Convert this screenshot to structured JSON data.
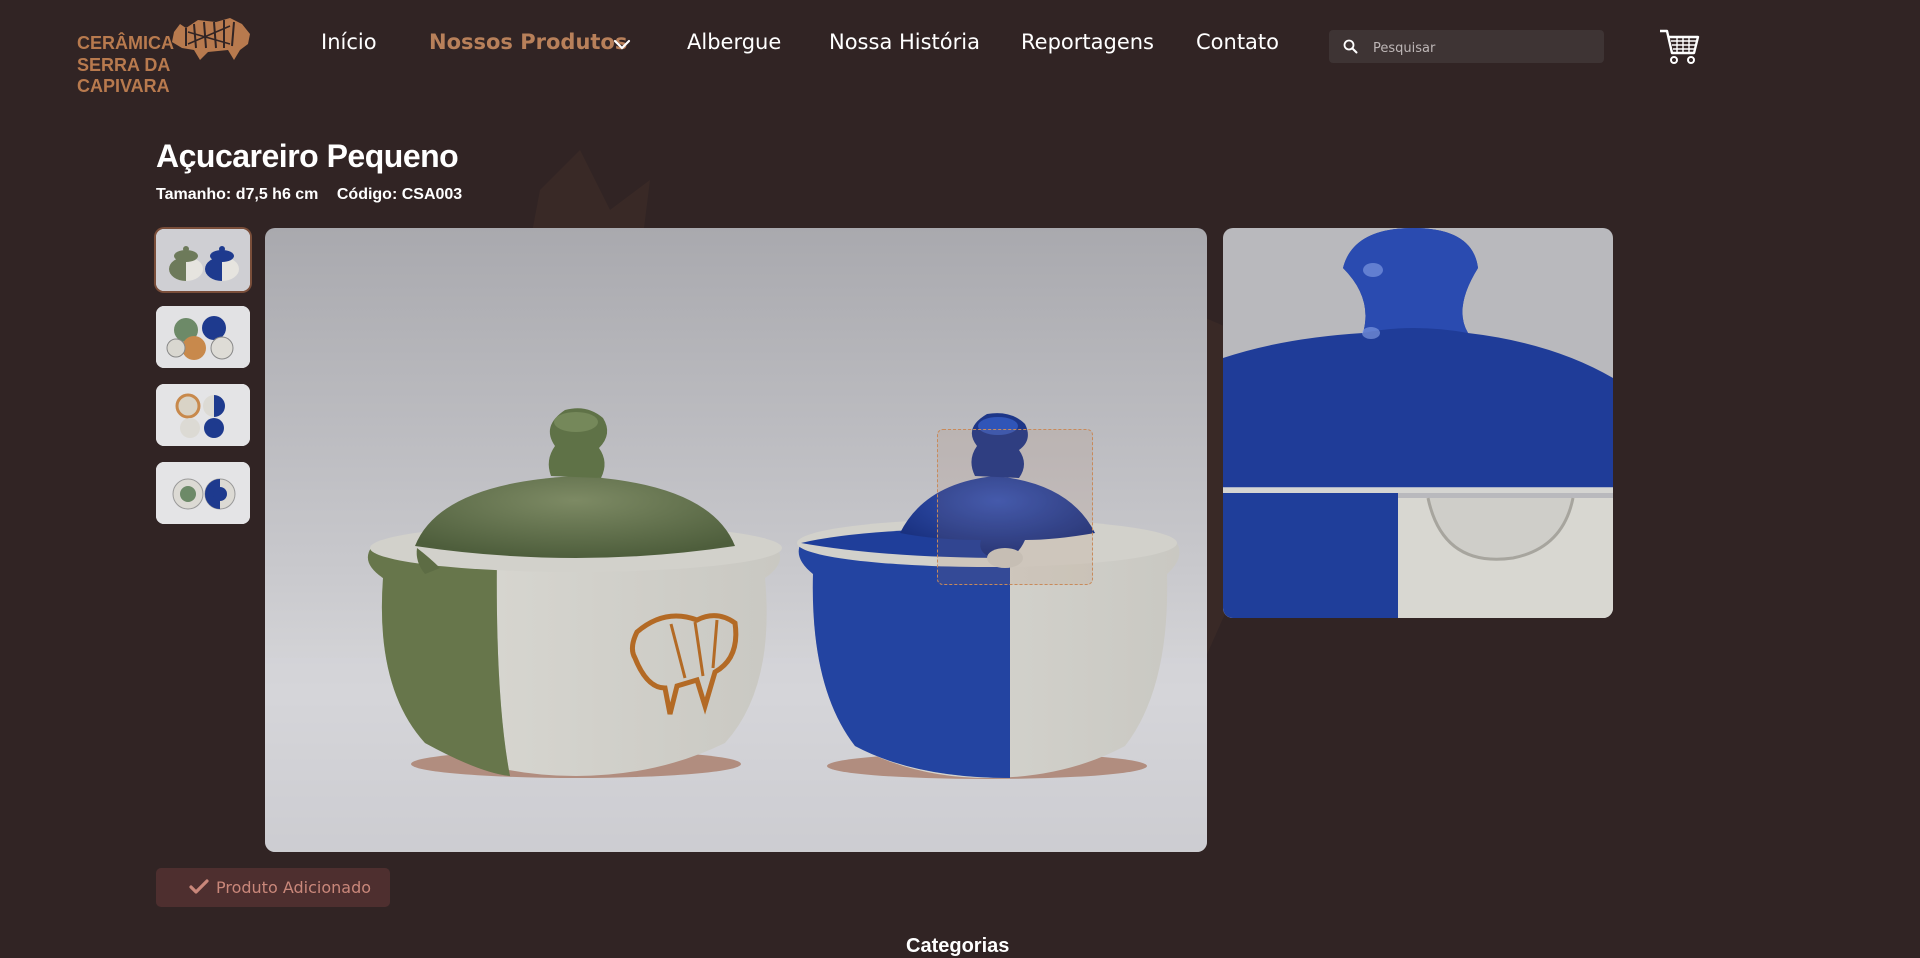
{
  "brand": {
    "line1": "CERÂMICA",
    "line2": "SERRA DA CAPIVARA",
    "color": "#b87a4e"
  },
  "nav": {
    "items": [
      {
        "label": "Início"
      },
      {
        "label": "Nossos Produtos",
        "active": true,
        "icon": "chevron-down-icon"
      },
      {
        "label": "Albergue"
      },
      {
        "label": "Nossa História"
      },
      {
        "label": "Reportagens"
      },
      {
        "label": "Contato"
      }
    ],
    "active_color": "#b8805a"
  },
  "search": {
    "placeholder": "Pesquisar",
    "icon": "search-icon"
  },
  "cart": {
    "icon": "cart-icon"
  },
  "product": {
    "title": "Açucareiro Pequeno",
    "size": "Tamanho: d7,5 h6 cm",
    "code": "Código: CSA003",
    "images": {
      "count": 4,
      "selected": 1
    }
  },
  "actions": {
    "added_label": "Produto Adicionado",
    "added_icon": "check-icon"
  },
  "section": {
    "categories_label": "Categorias"
  },
  "colors": {
    "background": "#312424",
    "button_bg": "#4e2f2f",
    "button_text": "#c9877a"
  }
}
